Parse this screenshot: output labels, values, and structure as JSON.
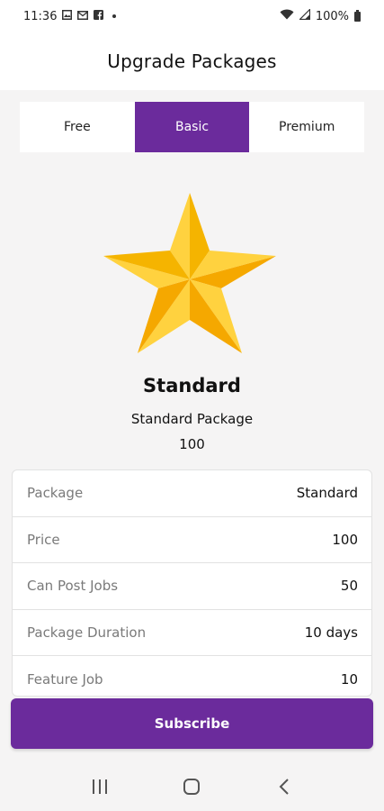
{
  "status_bar": {
    "time": "11:36",
    "battery": "100%",
    "icons": [
      "image-icon",
      "mail-icon",
      "facebook-icon",
      "dot-icon",
      "wifi-icon",
      "signal-icon",
      "battery-icon"
    ]
  },
  "header": {
    "title": "Upgrade Packages"
  },
  "tabs": [
    {
      "label": "Free",
      "active": false
    },
    {
      "label": "Basic",
      "active": true
    },
    {
      "label": "Premium",
      "active": false
    }
  ],
  "package": {
    "icon": "star-icon",
    "name": "Standard",
    "description": "Standard Package",
    "price": "100"
  },
  "details": [
    {
      "label": "Package",
      "value": "Standard"
    },
    {
      "label": "Price",
      "value": "100"
    },
    {
      "label": "Can Post Jobs",
      "value": "50"
    },
    {
      "label": "Package Duration",
      "value": "10 days"
    },
    {
      "label": "Feature Job",
      "value": "10"
    }
  ],
  "subscribe": {
    "label": "Subscribe"
  },
  "nav": {
    "icons": [
      "recent-apps-icon",
      "home-icon",
      "back-icon"
    ]
  },
  "colors": {
    "accent": "#6b2b9c",
    "star_light": "#ffd23f",
    "star_dark": "#f5a800",
    "background": "#f5f4f4"
  }
}
